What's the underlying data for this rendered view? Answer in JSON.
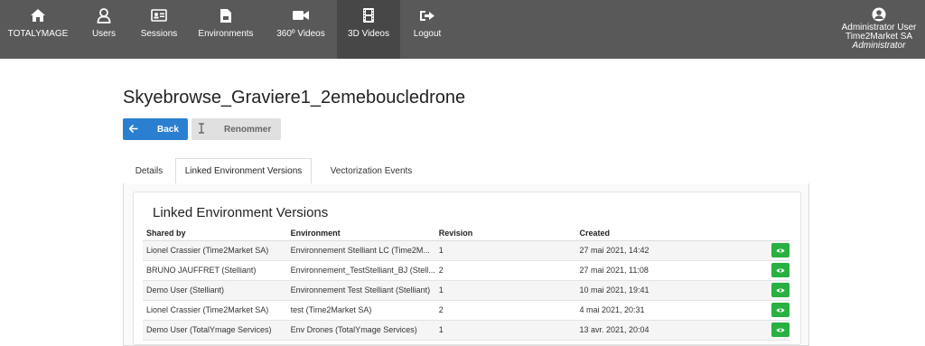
{
  "nav": {
    "items": [
      {
        "label": "TOTALYMAGE",
        "icon": "home-icon"
      },
      {
        "label": "Users",
        "icon": "user-icon"
      },
      {
        "label": "Sessions",
        "icon": "id-card-icon"
      },
      {
        "label": "Environments",
        "icon": "file-icon"
      },
      {
        "label": "360º Videos",
        "icon": "video-camera-icon"
      },
      {
        "label": "3D Videos",
        "icon": "film-icon"
      },
      {
        "label": "Logout",
        "icon": "logout-icon"
      }
    ],
    "user": {
      "name": "Administrator User",
      "company": "Time2Market SA",
      "role": "Administrator"
    }
  },
  "page": {
    "title": "Skyebrowse_Graviere1_2emeboucledrone",
    "back_label": "Back",
    "rename_label": "Renommer"
  },
  "tabs": [
    "Details",
    "Linked Environment Versions",
    "Vectorization Events"
  ],
  "card": {
    "title": "Linked Environment Versions",
    "columns": [
      "Shared by",
      "Environment",
      "Revision",
      "Created"
    ],
    "rows": [
      {
        "shared_by": "Lionel Crassier (Time2Market SA)",
        "environment": "Environnement Stelliant LC (Time2M...",
        "revision": "1",
        "created": "27 mai 2021, 14:42"
      },
      {
        "shared_by": "BRUNO JAUFFRET (Stelliant)",
        "environment": "Environnement_TestStelliant_BJ (Stell...",
        "revision": "2",
        "created": "27 mai 2021, 11:08"
      },
      {
        "shared_by": "Demo User (Stelliant)",
        "environment": "Environnement Test Stelliant (Stelliant)",
        "revision": "1",
        "created": "10 mai 2021, 19:41"
      },
      {
        "shared_by": "Lionel Crassier (Time2Market SA)",
        "environment": "test (Time2Market SA)",
        "revision": "2",
        "created": "4 mai 2021, 20:31"
      },
      {
        "shared_by": "Demo User (TotalYmage Services)",
        "environment": "Env Drones (TotalYmage Services)",
        "revision": "1",
        "created": "13 avr. 2021, 20:04"
      }
    ]
  },
  "colors": {
    "topbar": "#595959",
    "active_nav": "#474747",
    "primary": "#2b7fd1",
    "view_button": "#28b040"
  }
}
